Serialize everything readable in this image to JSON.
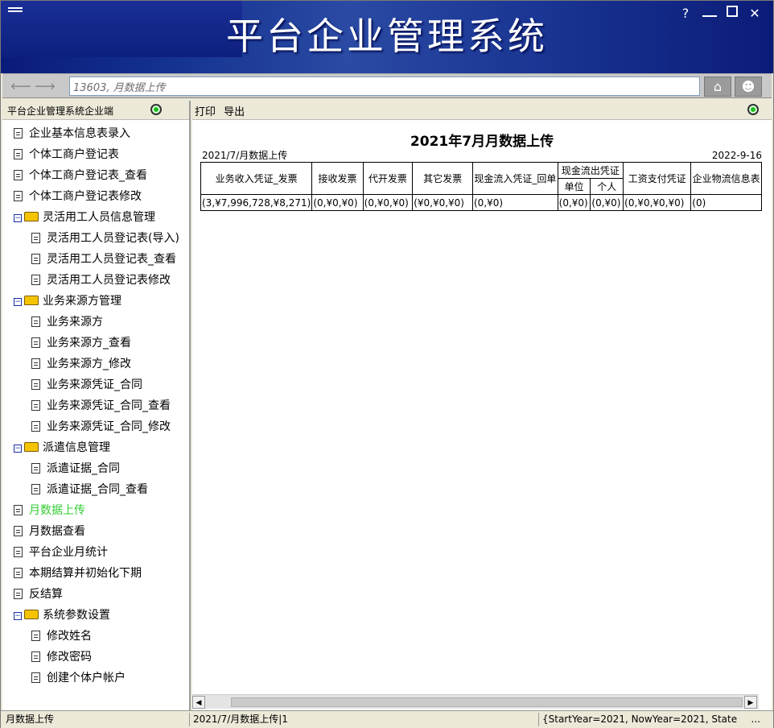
{
  "window": {
    "title": "平台企业管理系统",
    "controls": [
      "?",
      "minimize",
      "maximize",
      "close"
    ]
  },
  "addressbar": {
    "path": "13603, 月数据上传"
  },
  "left_panel": {
    "header": "平台企业管理系统企业端",
    "items": [
      {
        "label": "企业基本信息表录入",
        "type": "doc",
        "level": 0
      },
      {
        "label": "个体工商户登记表",
        "type": "doc",
        "level": 0
      },
      {
        "label": "个体工商户登记表_查看",
        "type": "doc",
        "level": 0
      },
      {
        "label": "个体工商户登记表修改",
        "type": "doc",
        "level": 0
      },
      {
        "label": "灵活用工人员信息管理",
        "type": "folder",
        "level": 0
      },
      {
        "label": "灵活用工人员登记表(导入)",
        "type": "doc",
        "level": 1
      },
      {
        "label": "灵活用工人员登记表_查看",
        "type": "doc",
        "level": 1
      },
      {
        "label": "灵活用工人员登记表修改",
        "type": "doc",
        "level": 1
      },
      {
        "label": "业务来源方管理",
        "type": "folder",
        "level": 0
      },
      {
        "label": "业务来源方",
        "type": "doc",
        "level": 1
      },
      {
        "label": "业务来源方_查看",
        "type": "doc",
        "level": 1
      },
      {
        "label": "业务来源方_修改",
        "type": "doc",
        "level": 1
      },
      {
        "label": "业务来源凭证_合同",
        "type": "doc",
        "level": 1
      },
      {
        "label": "业务来源凭证_合同_查看",
        "type": "doc",
        "level": 1
      },
      {
        "label": "业务来源凭证_合同_修改",
        "type": "doc",
        "level": 1
      },
      {
        "label": "派遣信息管理",
        "type": "folder",
        "level": 0
      },
      {
        "label": "派遣证据_合同",
        "type": "doc",
        "level": 1
      },
      {
        "label": "派遣证据_合同_查看",
        "type": "doc",
        "level": 1
      },
      {
        "label": "月数据上传",
        "type": "doc",
        "level": 0,
        "active": true
      },
      {
        "label": "月数据查看",
        "type": "doc",
        "level": 0
      },
      {
        "label": "平台企业月统计",
        "type": "doc",
        "level": 0
      },
      {
        "label": "本期结算并初始化下期",
        "type": "doc",
        "level": 0
      },
      {
        "label": "反结算",
        "type": "doc",
        "level": 0
      },
      {
        "label": "系统参数设置",
        "type": "folder",
        "level": 0
      },
      {
        "label": "修改姓名",
        "type": "doc",
        "level": 1
      },
      {
        "label": "修改密码",
        "type": "doc",
        "level": 1
      },
      {
        "label": "创建个体户帐户",
        "type": "doc",
        "level": 1
      }
    ]
  },
  "toolbar": {
    "print_label": "打印",
    "export_label": "导出"
  },
  "report": {
    "title": "2021年7月月数据上传",
    "subtitle_left": "2021/7/月数据上传",
    "date_right": "2022-9-16",
    "headers": {
      "col1": "业务收入凭证_发票",
      "col2": "接收发票",
      "col3": "代开发票",
      "col4": "其它发票",
      "col5": "现金流入凭证_回单",
      "col6_group": "现金流出凭证",
      "col6a": "单位",
      "col6b": "个人",
      "col7": "工资支付凭证",
      "col8": "企业物流信息表"
    },
    "row": {
      "col1": "(3,¥7,996,728,¥8,271)",
      "col2": "(0,¥0,¥0)",
      "col3": "(0,¥0,¥0)",
      "col4": "(¥0,¥0,¥0)",
      "col5": "(0,¥0)",
      "col6a": "(0,¥0)",
      "col6b": "(0,¥0)",
      "col7": "(0,¥0,¥0,¥0)",
      "col8": "(0)"
    }
  },
  "statusbar": {
    "left": "月数据上传",
    "middle": "2021/7/月数据上传|1",
    "right": "{StartYear=2021, NowYear=2021, State",
    "ellipsis": "..."
  },
  "colors": {
    "banner": "#13308f",
    "active_item": "#33cc33",
    "status_dot": "#1ac01a"
  }
}
